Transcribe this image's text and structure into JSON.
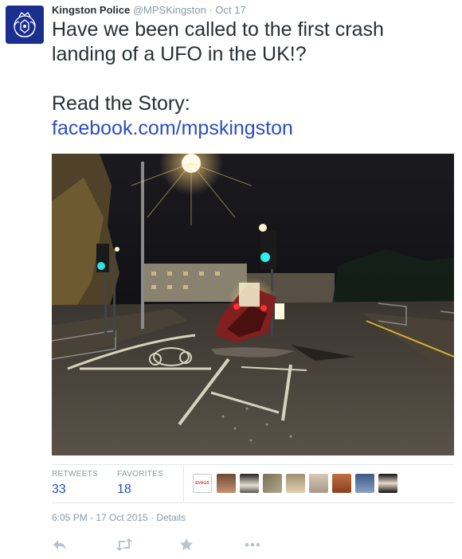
{
  "tweet": {
    "author_name": "Kingston Police",
    "author_handle": "@MPSKingston",
    "separator": "·",
    "date": "Oct 17",
    "text_line1": "Have we been called to the first crash",
    "text_line2": "landing of a UFO in the UK!?",
    "text_line3": "Read the Story:",
    "link": "facebook.com/mpskingston"
  },
  "stats": {
    "retweets_label": "RETWEETS",
    "retweets_value": "33",
    "favorites_label": "FAVORITES",
    "favorites_value": "18",
    "first_avatar_text": "EVAGS"
  },
  "meta": {
    "timestamp": "6:05 PM - 17 Oct 2015",
    "separator": "·",
    "details_label": "Details"
  },
  "colors": {
    "link": "#2b4ec6",
    "muted": "#8899a6",
    "text": "#292f33",
    "avatar_bg": "#1b2f8e"
  },
  "icons": [
    "reply-icon",
    "retweet-icon",
    "favorite-icon",
    "more-icon"
  ]
}
